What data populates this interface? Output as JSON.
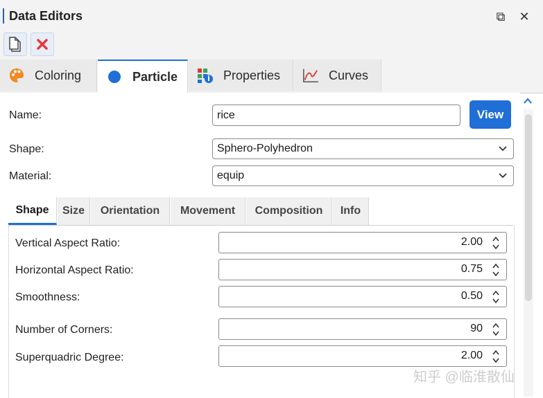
{
  "window": {
    "title": "Data Editors",
    "restore_symbol": "⧉",
    "close_symbol": "✕"
  },
  "toolbar": {
    "new_icon": "new-document-icon",
    "delete_icon": "delete-icon"
  },
  "tabs": [
    {
      "label": "Coloring",
      "icon": "palette-icon",
      "active": false
    },
    {
      "label": "Particle",
      "icon": "circle-icon",
      "active": true
    },
    {
      "label": "Properties",
      "icon": "properties-icon",
      "active": false
    },
    {
      "label": "Curves",
      "icon": "curve-chart-icon",
      "active": false
    }
  ],
  "form": {
    "name_label": "Name:",
    "name_value": "rice",
    "view_button": "View",
    "shape_label": "Shape:",
    "shape_value": "Sphero-Polyhedron",
    "material_label": "Material:",
    "material_value": "equip"
  },
  "subtabs": [
    {
      "label": "Shape",
      "active": true
    },
    {
      "label": "Size",
      "active": false
    },
    {
      "label": "Orientation",
      "active": false
    },
    {
      "label": "Movement",
      "active": false
    },
    {
      "label": "Composition",
      "active": false
    },
    {
      "label": "Info",
      "active": false
    }
  ],
  "shape_params": [
    {
      "label": "Vertical Aspect Ratio:",
      "value": "2.00"
    },
    {
      "label": "Horizontal Aspect Ratio:",
      "value": "0.75"
    },
    {
      "label": "Smoothness:",
      "value": "0.50"
    },
    {
      "label": "Number of Corners:",
      "value": "90"
    },
    {
      "label": "Superquadric Degree:",
      "value": "2.00"
    }
  ],
  "watermark": "知乎 @临淮散仙",
  "colors": {
    "accent": "#1f6fd6",
    "delete_red": "#e23b3b"
  }
}
